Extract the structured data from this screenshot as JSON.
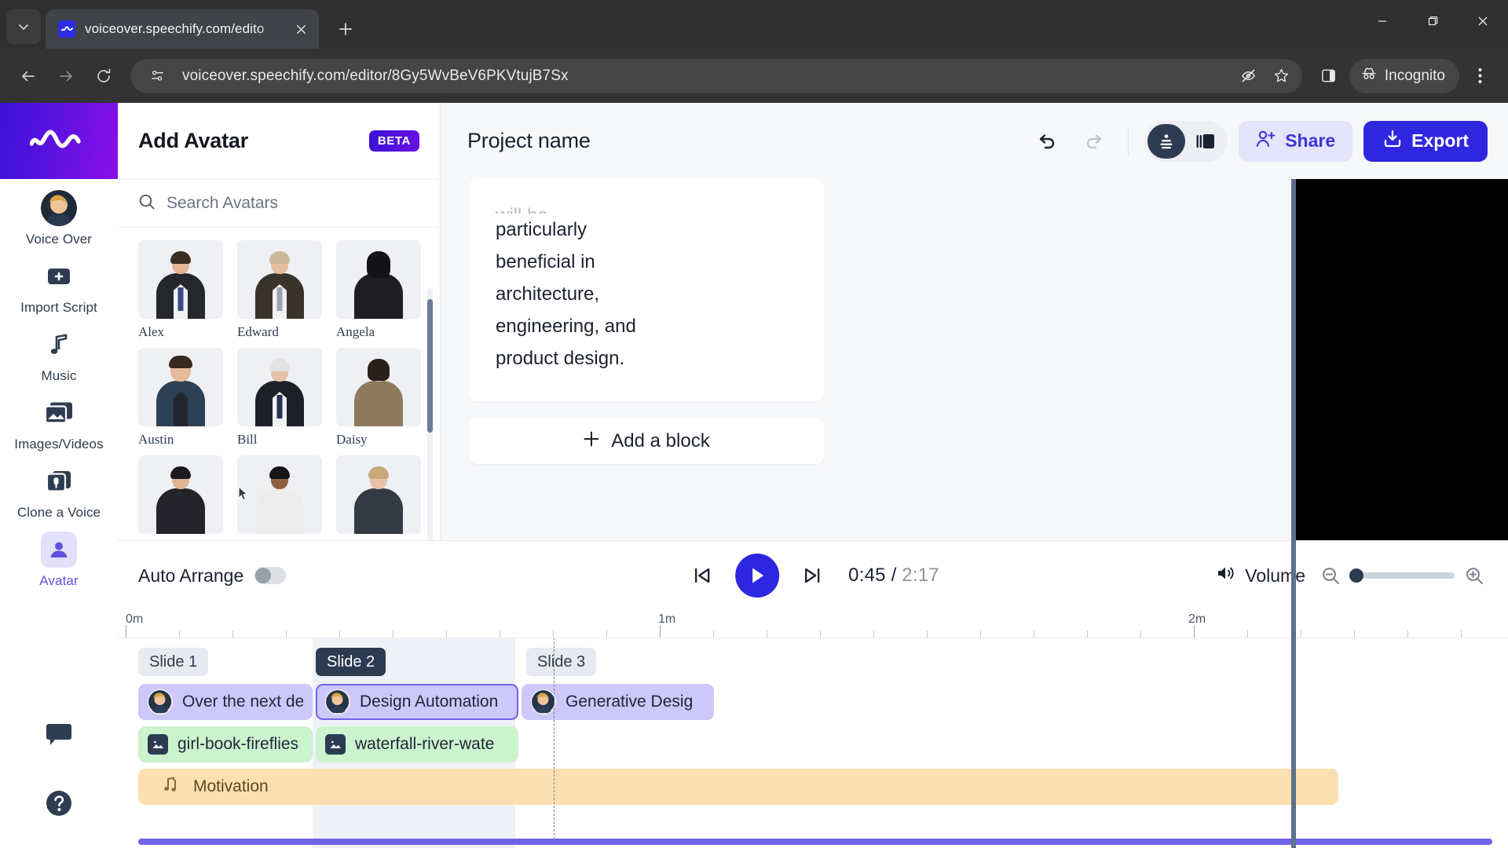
{
  "browser": {
    "tab": {
      "title": "voiceover.speechify.com/edito",
      "favicon": "speechify-icon"
    },
    "new_tab_label": "+",
    "url": "voiceover.speechify.com/editor/8Gy5WvBeV6PKVtujB7Sx",
    "profile_label": "Incognito",
    "icons": {
      "back": "back-arrow-icon",
      "forward": "forward-arrow-icon",
      "reload": "reload-icon",
      "site_info": "site-settings-icon",
      "tracking": "eye-off-icon",
      "bookmark": "star-icon",
      "side_panel": "side-panel-icon",
      "incognito": "incognito-icon",
      "menu": "kebab-menu-icon",
      "minimize": "minimize-icon",
      "maximize": "maximize-icon",
      "close": "close-icon"
    }
  },
  "rail": {
    "logo": "speechify-logo",
    "items": [
      {
        "label": "Voice Over",
        "icon": "voice-over-avatar-icon",
        "active": false
      },
      {
        "label": "Import Script",
        "icon": "plus-square-icon",
        "active": false
      },
      {
        "label": "Music",
        "icon": "music-note-icon",
        "active": false
      },
      {
        "label": "Images/Videos",
        "icon": "images-videos-icon",
        "active": false
      },
      {
        "label": "Clone a Voice",
        "icon": "clone-voice-icon",
        "active": false
      },
      {
        "label": "Avatar",
        "icon": "avatar-person-icon",
        "active": true
      }
    ],
    "bottom": [
      {
        "icon": "chat-bubble-icon"
      },
      {
        "icon": "help-circle-icon"
      }
    ]
  },
  "avatar_panel": {
    "title": "Add Avatar",
    "badge": "BETA",
    "search": {
      "placeholder": "Search Avatars",
      "value": "",
      "icon": "search-icon"
    },
    "avatars": [
      {
        "name": "Alex",
        "suit": "#26272c",
        "hair": "#3b2d22",
        "skin": "#e3b695",
        "tie": "#3c4a82"
      },
      {
        "name": "Edward",
        "suit": "#3a332c",
        "hair": "#c9b89a",
        "skin": "#e6bd9c",
        "tie": "#9da3ae"
      },
      {
        "name": "Angela",
        "suit": "#1d1d22",
        "hair": "#141317",
        "skin": "#e0b292",
        "tie": "#1d1d22"
      },
      {
        "name": "Austin",
        "suit": "#2e4054",
        "hair": "#3a2a1e",
        "skin": "#e5b99a",
        "tie": "#23262e"
      },
      {
        "name": "Bill",
        "suit": "#1f2027",
        "hair": "#e2e2e2",
        "skin": "#e6c0a2",
        "tie": "#2b3150"
      },
      {
        "name": "Daisy",
        "suit": "#8e7a5c",
        "hair": "#2a211a",
        "skin": "#e4bb9c",
        "tie": "#8e7a5c"
      },
      {
        "name": "",
        "suit": "#24242a",
        "hair": "#1b1a1f",
        "skin": "#e2b493",
        "tie": "#2b2b33"
      },
      {
        "name": "",
        "suit": "#ececec",
        "hair": "#161417",
        "skin": "#8b5f3f",
        "tie": "#ececec"
      },
      {
        "name": "",
        "suit": "#343a44",
        "hair": "#c8a878",
        "skin": "#e8c2a3",
        "tie": "#2a2f38"
      }
    ]
  },
  "editor": {
    "project_name": "Project name",
    "undo_icon": "undo-icon",
    "redo_icon": "redo-icon",
    "view_avatar_icon": "avatar-view-icon",
    "view_slides_icon": "slides-view-icon",
    "share_label": "Share",
    "share_icon": "share-person-icon",
    "export_label": "Export",
    "export_icon": "export-download-icon",
    "script_lines": [
      "will be",
      "particularly",
      "beneficial in",
      "architecture,",
      "engineering, and",
      "product design."
    ],
    "add_block_label": "Add a block",
    "add_block_icon": "plus-icon"
  },
  "transport": {
    "auto_arrange_label": "Auto Arrange",
    "auto_arrange_on": false,
    "skip_back_icon": "skip-back-icon",
    "play_icon": "play-icon",
    "skip_forward_icon": "skip-forward-icon",
    "current_time": "0:45",
    "separator": " / ",
    "total_time": "2:17",
    "volume_label": "Volume",
    "volume_icon": "volume-icon",
    "zoom_out_icon": "zoom-out-icon",
    "zoom_in_icon": "zoom-in-icon",
    "zoom_value": 0
  },
  "timeline": {
    "ruler_labels": [
      "0m",
      "1m",
      "2m"
    ],
    "playhead_time": "0:45",
    "slides": [
      {
        "label": "Slide 1",
        "active": false
      },
      {
        "label": "Slide 2",
        "active": true
      },
      {
        "label": "Slide 3",
        "active": false
      }
    ],
    "voice_clips": [
      {
        "text": "Over the next de",
        "selected": false
      },
      {
        "text": "Design Automation",
        "selected": true
      },
      {
        "text": "Generative Desig",
        "selected": false
      }
    ],
    "media_clips": [
      {
        "text": "girl-book-fireflies",
        "icon": "image-icon"
      },
      {
        "text": "waterfall-river-wate",
        "icon": "image-icon"
      }
    ],
    "music_clips": [
      {
        "text": "Motivation",
        "icon": "music-notes-icon"
      }
    ]
  }
}
